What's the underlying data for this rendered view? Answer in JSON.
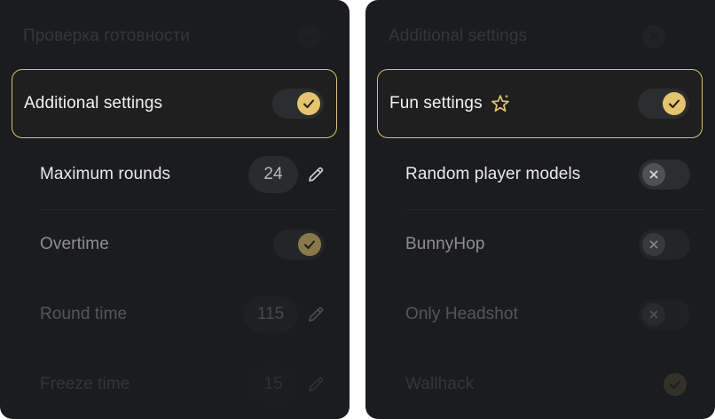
{
  "left_panel": {
    "top_faded_label": "Проверка готовности",
    "header": {
      "label": "Additional settings",
      "toggle": "on"
    },
    "items": [
      {
        "label": "Maximum rounds",
        "value": "24"
      },
      {
        "label": "Overtime",
        "toggle": "on"
      },
      {
        "label": "Round time",
        "value": "115"
      },
      {
        "label": "Freeze time",
        "value": "15"
      }
    ]
  },
  "right_panel": {
    "top_faded_label": "Additional settings",
    "header": {
      "label": "Fun settings",
      "toggle": "on",
      "icon": "sparkle-star-icon"
    },
    "items": [
      {
        "label": "Random player models",
        "toggle": "off"
      },
      {
        "label": "BunnyHop",
        "toggle": "off"
      },
      {
        "label": "Only Headshot",
        "toggle": "off"
      },
      {
        "label": "Wallhack",
        "toggle": "on"
      }
    ]
  },
  "colors": {
    "accent": "#e6c56a",
    "panel_bg": "#1b1c1f",
    "border_highlight": "#d9bf6c"
  }
}
